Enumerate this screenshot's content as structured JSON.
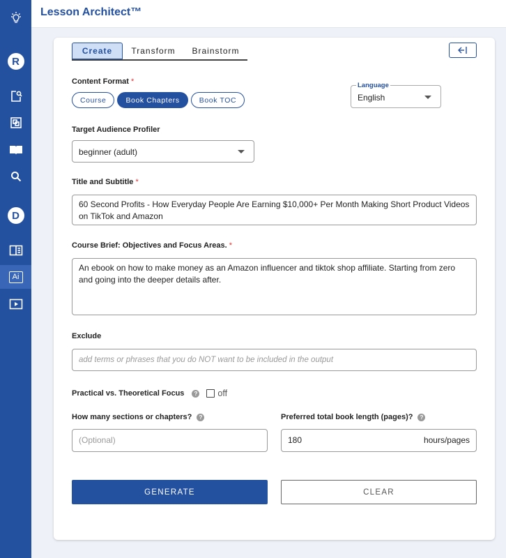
{
  "app": {
    "title": "Lesson Architect™"
  },
  "sidebar": {
    "items": [
      {
        "icon": "lightbulb-icon"
      },
      {
        "icon": "avatar-r",
        "letter": "R"
      },
      {
        "icon": "document-search-icon"
      },
      {
        "icon": "layers-icon"
      },
      {
        "icon": "book-open-icon"
      },
      {
        "icon": "search-icon"
      },
      {
        "icon": "avatar-d",
        "letter": "D"
      },
      {
        "icon": "panel-icon"
      },
      {
        "icon": "ai-icon",
        "text": "Ai"
      },
      {
        "icon": "video-icon"
      }
    ]
  },
  "tabs": [
    {
      "label": "Create",
      "active": true
    },
    {
      "label": "Transform",
      "active": false
    },
    {
      "label": "Brainstorm",
      "active": false
    }
  ],
  "content_format": {
    "label": "Content Format",
    "required": "*",
    "options": [
      {
        "label": "Course",
        "selected": false
      },
      {
        "label": "Book Chapters",
        "selected": true
      },
      {
        "label": "Book TOC",
        "selected": false
      }
    ]
  },
  "language": {
    "legend": "Language",
    "value": "English"
  },
  "audience": {
    "label": "Target Audience Profiler",
    "value": "beginner (adult)"
  },
  "title_field": {
    "label": "Title and Subtitle",
    "required": "*",
    "value": "60 Second Profits - How Everyday People Are Earning $10,000+ Per Month Making Short Product Videos on TikTok and Amazon"
  },
  "brief": {
    "label": "Course Brief: Objectives and Focus Areas.",
    "required": "*",
    "value": "An ebook on how to make money as an Amazon influencer and tiktok shop affiliate. Starting from zero and going into the deeper details after."
  },
  "exclude": {
    "label": "Exclude",
    "placeholder": "add terms or phrases that you do NOT want to be included in the output"
  },
  "focus": {
    "label": "Practical vs. Theoretical Focus",
    "help": "?",
    "toggle_label": "off",
    "checked": false
  },
  "sections": {
    "label": "How many sections or chapters?",
    "help": "?",
    "placeholder": "(Optional)"
  },
  "length": {
    "label": "Preferred total book length (pages)?",
    "help": "?",
    "value": "180",
    "suffix": "hours/pages"
  },
  "buttons": {
    "generate": "GENERATE",
    "clear": "CLEAR"
  },
  "colors": {
    "primary": "#2450a0",
    "required": "#d33333",
    "background": "#eef2f8"
  }
}
